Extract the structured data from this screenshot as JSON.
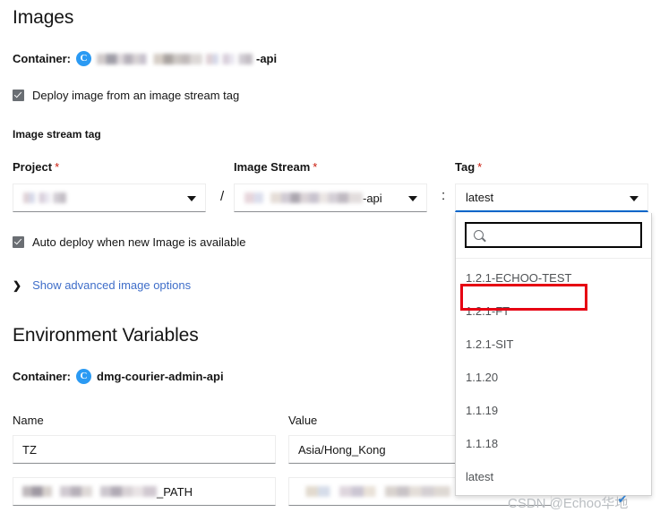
{
  "images_section": {
    "heading": "Images",
    "container_label": "Container:",
    "container_badge": "C",
    "container_name_suffix": "-api",
    "deploy_checkbox_label": "Deploy image from an image stream tag",
    "image_stream_tag_label": "Image stream tag",
    "project": {
      "label": "Project",
      "required_marker": "*",
      "value": ""
    },
    "separator_slash": "/",
    "image_stream": {
      "label": "Image Stream",
      "required_marker": "*",
      "value_suffix": "-api"
    },
    "separator_colon": ":",
    "tag": {
      "label": "Tag",
      "required_marker": "*",
      "value": "latest"
    },
    "auto_deploy_label": "Auto deploy when new Image is available",
    "advanced_link": "Show advanced image options",
    "chevron_icon": "❯"
  },
  "tag_dropdown": {
    "search_placeholder": "",
    "search_value": "",
    "items": [
      "1.2.1-ECHOO-TEST",
      "1.2.1-FT",
      "1.2.1-SIT",
      "1.1.20",
      "1.1.19",
      "1.1.18",
      "latest"
    ],
    "highlighted_item": "1.2.1-ECHOO-TEST",
    "highlight_color": "#e60012"
  },
  "env_section": {
    "heading": "Environment Variables",
    "container_label": "Container:",
    "container_badge": "C",
    "container_name": "dmg-courier-admin-api",
    "columns": {
      "name": "Name",
      "value": "Value"
    },
    "rows": [
      {
        "name": "TZ",
        "value": "Asia/Hong_Kong"
      },
      {
        "name_suffix": "_PATH",
        "value": ""
      }
    ]
  },
  "watermark": {
    "text": "CSDN @Echoo华地",
    "badge": "✔"
  },
  "colors": {
    "accent_blue": "#0066cc",
    "link_blue": "#3f6ec9",
    "badge_blue": "#2b9af3",
    "required_red": "#c9190b",
    "annotation_red": "#e60012"
  }
}
